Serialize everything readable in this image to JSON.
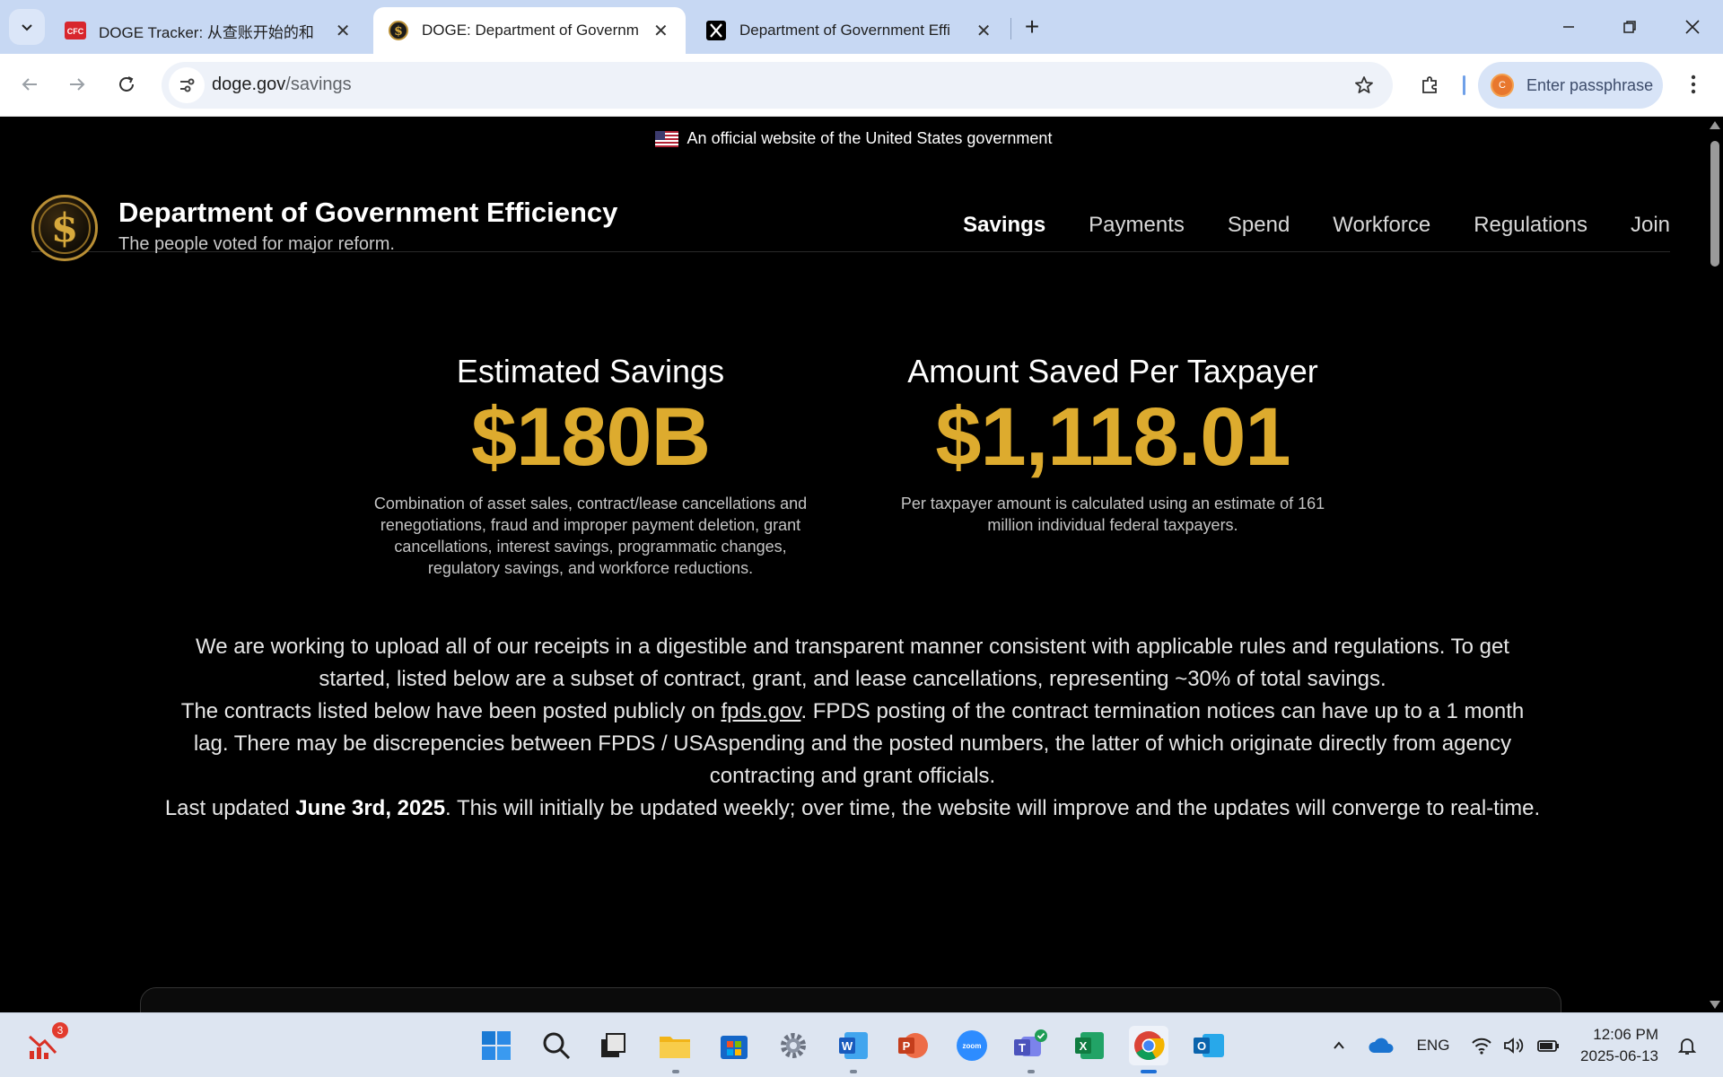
{
  "browser": {
    "tabs": [
      {
        "title": "DOGE Tracker: 从查账开始的和",
        "favicon": "cfc-favicon",
        "active": false
      },
      {
        "title": "DOGE: Department of Governm",
        "favicon": "doge-seal-favicon",
        "active": true
      },
      {
        "title": "Department of Government Effi",
        "favicon": "x-favicon",
        "active": false
      }
    ],
    "url_host": "doge.gov",
    "url_path": "/savings",
    "profile_label": "Enter passphrase",
    "profile_initial": "C"
  },
  "site": {
    "gov_banner": "An official website of the United States government",
    "name": "Department of Government Efficiency",
    "tagline": "The people voted for major reform.",
    "nav": [
      "Savings",
      "Payments",
      "Spend",
      "Workforce",
      "Regulations",
      "Join"
    ],
    "active_nav": "Savings"
  },
  "stats": {
    "savings_label": "Estimated Savings",
    "savings_value": "$180B",
    "savings_note": "Combination of asset sales, contract/lease cancellations and renegotiations, fraud and improper payment deletion, grant cancellations, interest savings, programmatic changes, regulatory savings, and workforce reductions.",
    "taxpayer_label": "Amount Saved Per Taxpayer",
    "taxpayer_value": "$1,118.01",
    "taxpayer_note": "Per taxpayer amount is calculated using an estimate of 161 million individual federal taxpayers."
  },
  "body": {
    "para1": "We are working to upload all of our receipts in a digestible and transparent manner consistent with applicable rules and regulations. To get started, listed below are a subset of contract, grant, and lease cancellations, representing ~30% of total savings.",
    "para2_before": "The contracts listed below have been posted publicly on ",
    "para2_link": "fpds.gov",
    "para2_after": ". FPDS posting of the contract termination notices can have up to a 1 month lag. There may be discrepencies between FPDS / USAspending and the posted numbers, the latter of which originate directly from agency contracting and grant officials.",
    "para3_before": "Last updated ",
    "para3_date": "June 3rd, 2025",
    "para3_after": ". This will initially be updated weekly; over time, the website will improve and the updates will converge to real-time."
  },
  "taskbar": {
    "notification_badge": "3",
    "language": "ENG",
    "time": "12:06 PM",
    "date": "2025-06-13"
  },
  "colors": {
    "accent_gold": "#ddab2e",
    "page_bg": "#000000",
    "chrome_tabbar": "#c7d8f3"
  }
}
